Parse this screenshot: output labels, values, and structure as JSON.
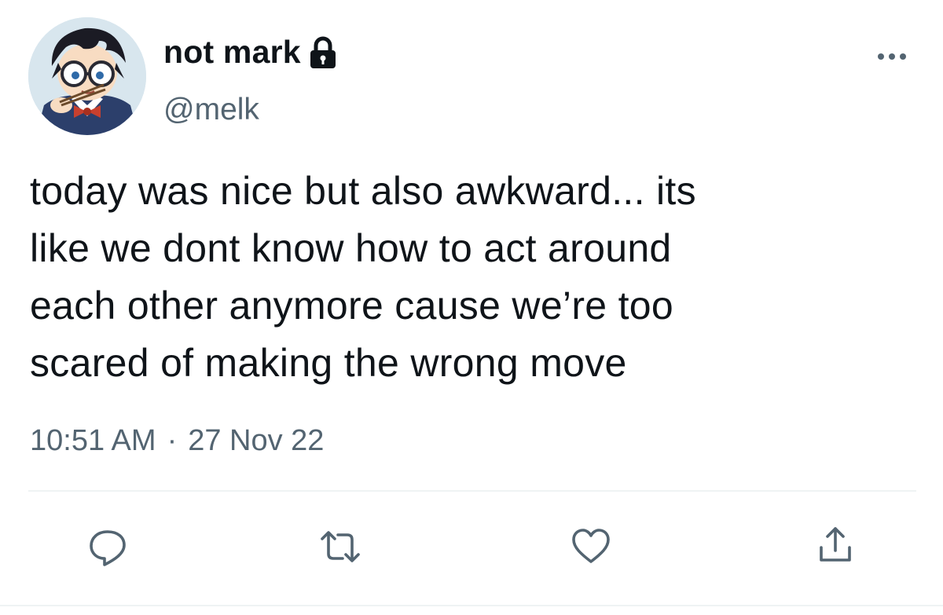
{
  "user": {
    "display_name": "not mark",
    "handle": "@melk",
    "avatar_icon": "cartoon-avatar",
    "protected_icon": "lock-icon"
  },
  "tweet": {
    "text": "today was nice but also awkward... its\nlike we dont know how to act around\neach other anymore cause we’re too\nscared of making the wrong move",
    "time": "10:51 AM",
    "separator": "·",
    "date": "27 Nov 22"
  },
  "actions": [
    {
      "name": "reply",
      "icon": "reply-icon"
    },
    {
      "name": "retweet",
      "icon": "retweet-icon"
    },
    {
      "name": "like",
      "icon": "heart-icon"
    },
    {
      "name": "share",
      "icon": "share-icon"
    }
  ],
  "colors": {
    "text": "#0f1419",
    "secondary": "#536471",
    "divider": "#eff3f4"
  }
}
